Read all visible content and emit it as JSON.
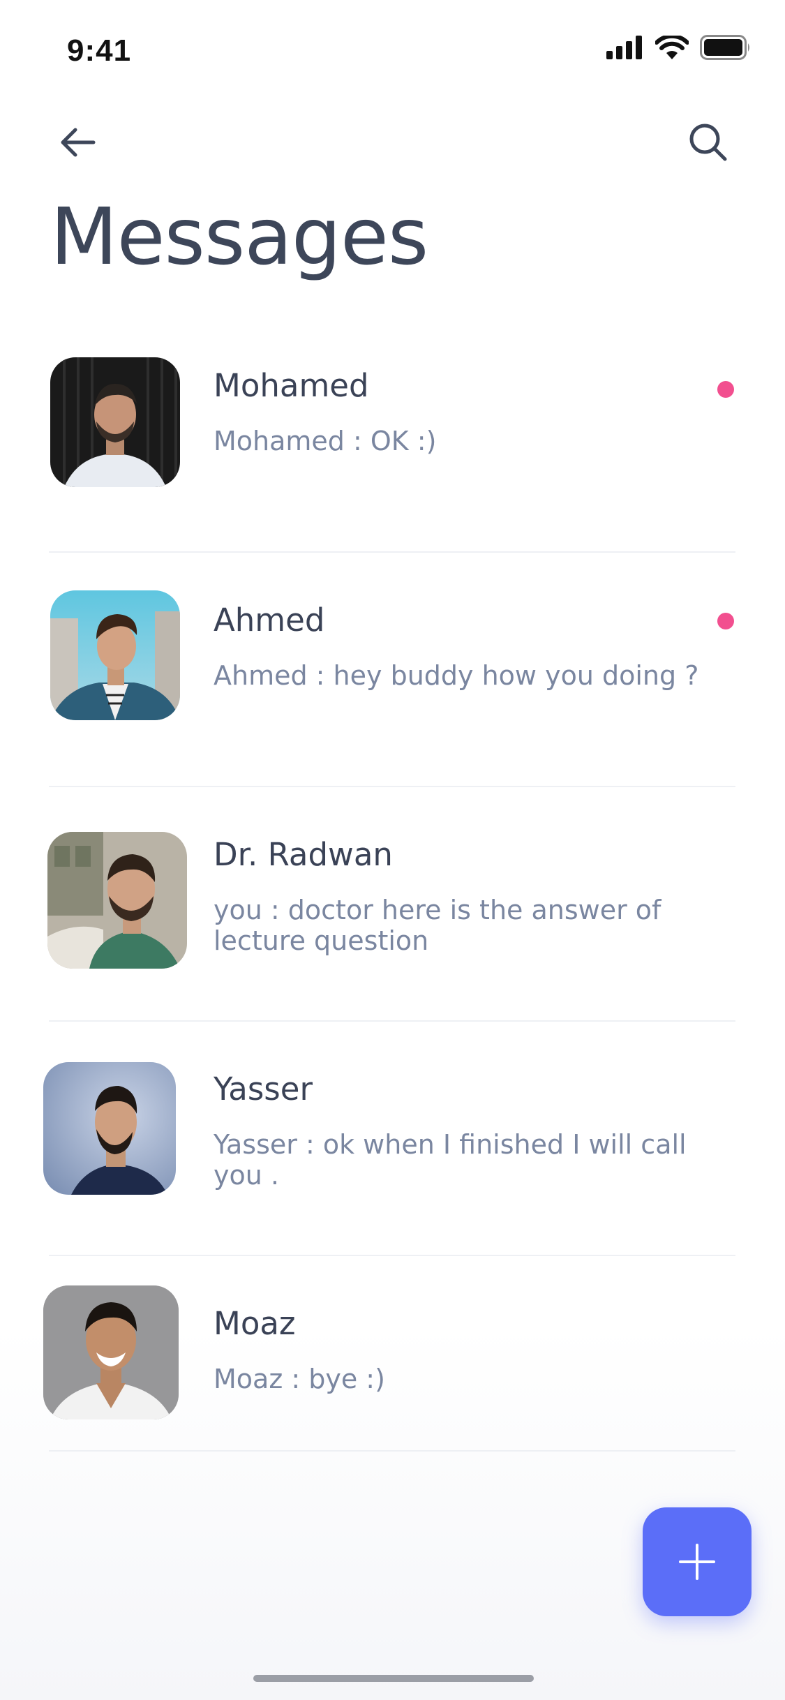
{
  "status_bar": {
    "time": "9:41"
  },
  "header": {
    "title": "Messages",
    "back_icon": "arrow-left-icon",
    "search_icon": "search-icon"
  },
  "colors": {
    "title": "#3d4659",
    "name": "#3a4256",
    "preview": "#7a86a0",
    "unread_dot": "#f24f8f",
    "fab": "#5b6ef8"
  },
  "conversations": [
    {
      "name": "Mohamed",
      "preview": "Mohamed : OK :)",
      "unread": true,
      "avatar": "avatar-photo"
    },
    {
      "name": "Ahmed",
      "preview": "Ahmed : hey buddy how you doing ?",
      "unread": true,
      "avatar": "avatar-photo"
    },
    {
      "name": "Dr. Radwan",
      "preview": "you : doctor here is the answer of lecture question",
      "unread": false,
      "avatar": "avatar-photo"
    },
    {
      "name": "Yasser",
      "preview": "Yasser : ok when I finished I will call you .",
      "unread": false,
      "avatar": "avatar-photo"
    },
    {
      "name": "Moaz",
      "preview": "Moaz : bye :)",
      "unread": false,
      "avatar": "avatar-photo"
    }
  ],
  "fab": {
    "icon": "plus-icon"
  }
}
